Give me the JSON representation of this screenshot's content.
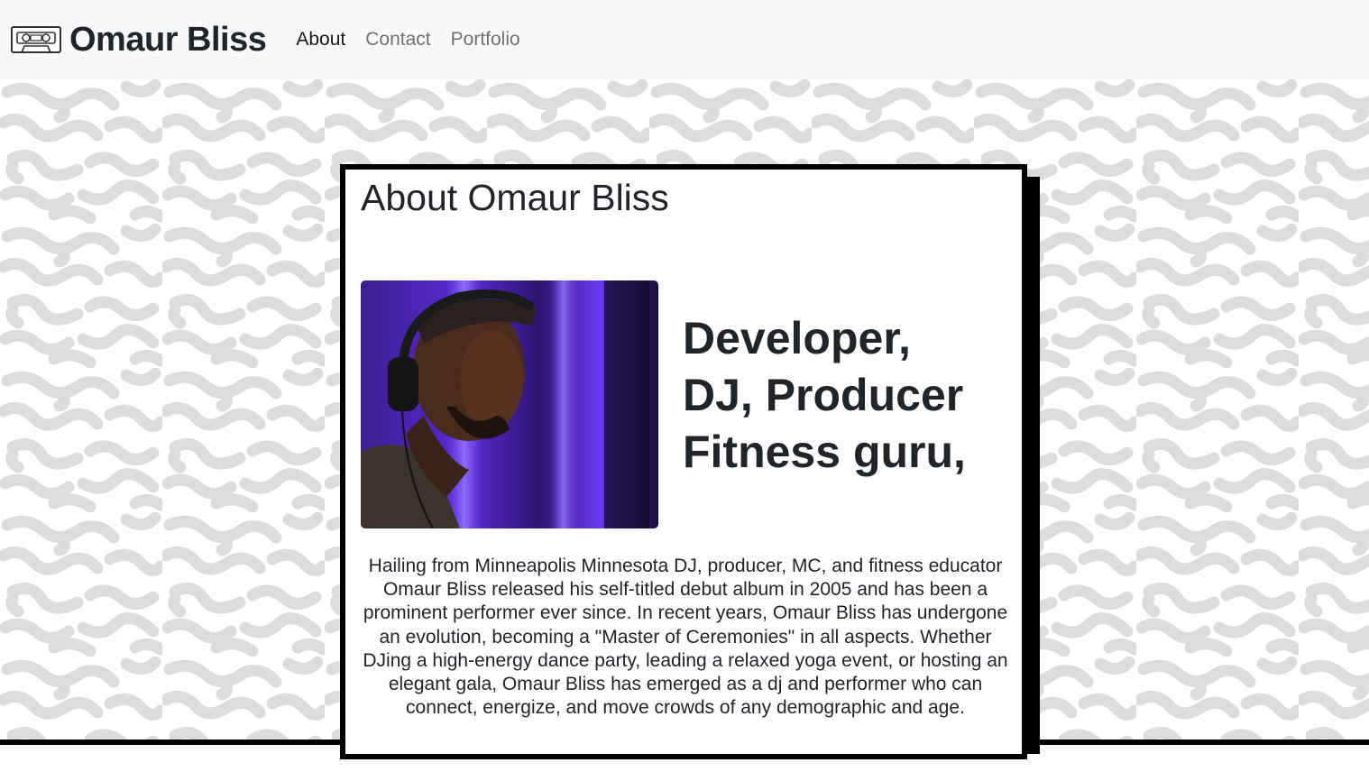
{
  "navbar": {
    "brand_name": "Omaur Bliss",
    "logo_icon": "cassette-tape-icon",
    "links": [
      {
        "label": "About",
        "active": true
      },
      {
        "label": "Contact",
        "active": false
      },
      {
        "label": "Portfolio",
        "active": false
      }
    ]
  },
  "about": {
    "title": "About Omaur Bliss",
    "portrait_icon": "dj-portrait-image",
    "tagline": [
      "Developer,",
      "DJ, Producer",
      "Fitness guru,"
    ],
    "bio": "Hailing from Minneapolis Minnesota DJ, producer, MC, and fitness educator Omaur Bliss released his self-titled debut album in 2005 and has been a prominent performer ever since. In recent years, Omaur Bliss has undergone an evolution, becoming a \"Master of Ceremonies\" in all aspects. Whether DJing a high-energy dance party, leading a relaxed yoga event, or hosting an elegant gala, Omaur Bliss has emerged as a dj and performer who can connect, energize, and move crowds of any demographic and age."
  },
  "colors": {
    "navbar_bg": "#f8f9fa",
    "pattern": "#dcdcdc",
    "card_border": "#000000",
    "text": "#212529",
    "muted_link": "#8c8c8c"
  }
}
